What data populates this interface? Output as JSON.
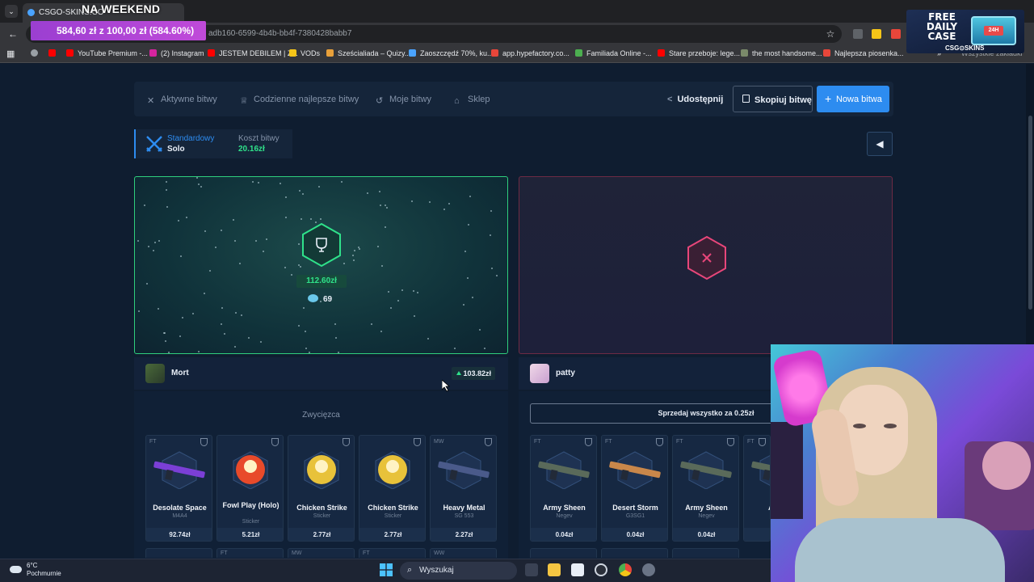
{
  "browser": {
    "tab_title": "CSGO-SKINS.CO",
    "stream_overlay_title": "NA WEEKEND",
    "url_visible": "adb160-6599-4b4b-bb4f-7380428babb7",
    "profit_overlay": "584,60 zł z 100,00 zł (584.60%)",
    "bookmarks": [
      "YouTube Premium -...",
      "(2) Instagram",
      "JESTEM DEBILEM | Z...",
      "VODs",
      "Sześcialiada – Quizy...",
      "Zaoszczędź 70%, ku...",
      "app.hypefactory.co...",
      "Familiada Online -...",
      "Stare przeboje: lege...",
      "the most handsome...",
      "Najlepsza piosenka..."
    ],
    "bookmarks_more": "Wszystkie zakładki"
  },
  "promo": {
    "line1": "FREE",
    "line2": "DAILY",
    "line3": "CASE",
    "badge": "24H",
    "brand": "CSG⊙SKINS"
  },
  "nav": {
    "active_battles": "Aktywne bitwy",
    "daily_best": "Codzienne najlepsze bitwy",
    "my_battles": "Moje bitwy",
    "shop": "Sklep",
    "share": "Udostępnij",
    "copy_battle": "Skopiuj bitwę",
    "new_battle": "Nowa bitwa"
  },
  "mode": {
    "type": "Standardowy",
    "players": "Solo",
    "cost_label": "Koszt bitwy",
    "cost_value": "20.16zł"
  },
  "winner_panel": {
    "value": "112.60zł",
    "coins": "69"
  },
  "player_left": {
    "name": "Mort",
    "total": "103.82zł",
    "status": "Zwycięzca",
    "items": [
      {
        "cond": "FT",
        "name": "Desolate Space",
        "sub": "M4A4",
        "price": "92.74zł",
        "color": "#7b3fd6"
      },
      {
        "cond": "",
        "name": "Fowl Play (Holo)",
        "sub": "Sticker",
        "price": "5.21zł",
        "color": "#e84a2a"
      },
      {
        "cond": "",
        "name": "Chicken Strike",
        "sub": "Sticker",
        "price": "2.77zł",
        "color": "#e8c23a"
      },
      {
        "cond": "",
        "name": "Chicken Strike",
        "sub": "Sticker",
        "price": "2.77zł",
        "color": "#e8c23a"
      },
      {
        "cond": "MW",
        "name": "Heavy Metal",
        "sub": "SG 553",
        "price": "2.27zł",
        "color": "#4a5a8a"
      }
    ],
    "row2_conds": [
      "",
      "FT",
      "MW",
      "FT",
      "WW"
    ]
  },
  "player_right": {
    "name": "patty",
    "sell_all": "Sprzedaj wszystko za 0.25zł",
    "items": [
      {
        "cond": "FT",
        "name": "Army Sheen",
        "sub": "Negev",
        "price": "0.04zł",
        "color": "#5a6a5a"
      },
      {
        "cond": "FT",
        "name": "Desert Storm",
        "sub": "G3SG1",
        "price": "0.04zł",
        "color": "#c9874a"
      },
      {
        "cond": "FT",
        "name": "Army Sheen",
        "sub": "Negev",
        "price": "0.04zł",
        "color": "#5a6a5a"
      },
      {
        "cond": "FT",
        "name": "Army",
        "sub": "",
        "price": "",
        "color": "#5a6a5a"
      }
    ]
  },
  "taskbar": {
    "temp": "6°C",
    "weather": "Pochmurnie",
    "search": "Wyszukaj"
  }
}
